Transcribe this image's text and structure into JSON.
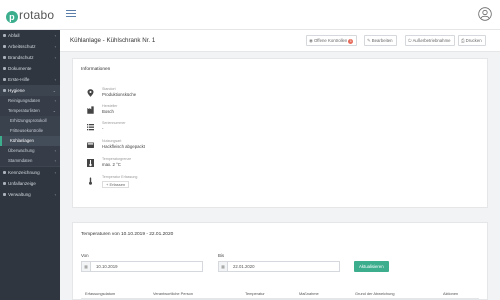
{
  "app": {
    "logo_text": "rotabo",
    "logo_letter": "p"
  },
  "sidebar": {
    "items": [
      {
        "label": "Abfall",
        "caret": "‹"
      },
      {
        "label": "Arbeitsschutz",
        "caret": "‹"
      },
      {
        "label": "Brandschutz",
        "caret": "‹"
      },
      {
        "label": "Dokumente",
        "caret": ""
      },
      {
        "label": "Erste-Hilfe",
        "caret": "‹"
      },
      {
        "label": "Hygiene",
        "caret": "⌄"
      }
    ],
    "hygiene_children": [
      {
        "label": "Reinigungsdaten",
        "caret": "‹"
      },
      {
        "label": "Temperaturlisten",
        "caret": "⌄"
      },
      {
        "label": "Erhitzungsprotokoll",
        "caret": ""
      },
      {
        "label": "Fritteusekontrolle",
        "caret": ""
      },
      {
        "label": "Kühlanlagen",
        "caret": ""
      },
      {
        "label": "Überwachung",
        "caret": "‹"
      },
      {
        "label": "Stammdaten",
        "caret": "‹"
      }
    ],
    "bottom_items": [
      {
        "label": "Kennzeichnung",
        "caret": "‹"
      },
      {
        "label": "Unfallanzeige",
        "caret": ""
      },
      {
        "label": "Verwaltung",
        "caret": "‹"
      }
    ]
  },
  "page": {
    "title": "Kühlanlage - Kühlschrank Nr. 1",
    "buttons": {
      "open_controls": "Offene Kontrollen",
      "open_controls_count": "1",
      "edit": "Bearbeiten",
      "deactivate": "Außerbetriebnahme",
      "print": "Drucken"
    }
  },
  "info": {
    "heading": "Informationen",
    "rows": [
      {
        "label": "Standort",
        "value": "Produktionsküche",
        "icon": "map-pin-icon"
      },
      {
        "label": "Hersteller",
        "value": "Bosch",
        "icon": "factory-icon"
      },
      {
        "label": "Seriennummer",
        "value": "-",
        "icon": "list-icon"
      },
      {
        "label": "Nutzungsart",
        "value": "Hackfleisch abgepackt",
        "icon": "truck-icon"
      },
      {
        "label": "Temperaturgrenze",
        "value": "max. 2 °C",
        "icon": "thermometer-icon"
      },
      {
        "label": "Temperatur Erfassung",
        "value": "",
        "icon": "thermometer-small-icon",
        "add_label": "+ Erfassen"
      }
    ]
  },
  "temperatures": {
    "heading": "Temperaturen von 10.10.2019 - 22.01.2020",
    "from_label": "Von",
    "from_value": "10.10.2019",
    "to_label": "Bis",
    "to_value": "22.01.2020",
    "update_button": "Aktualisieren",
    "columns": [
      "Erfassungsdatum",
      "Verantwortliche Person",
      "Temperatur",
      "Maßnahme",
      "Grund der Abweichung",
      "Aktionen"
    ]
  },
  "colors": {
    "accent": "#3cae8e",
    "sidebar": "#2f3640",
    "badge": "#e66b5b"
  }
}
